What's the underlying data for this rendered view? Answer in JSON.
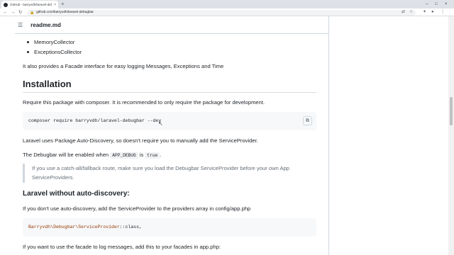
{
  "browser": {
    "tab_title": "GitHub - barryvdh/laravel-debugbar",
    "tab_close": "×",
    "new_tab": "+",
    "url": "github.com/barryvdh/laravel-debugbar",
    "window_controls": {
      "minimize": "–",
      "maximize": "□",
      "close": "×"
    },
    "nav": {
      "back": "←",
      "forward": "→",
      "reload": "↻",
      "lock": "🔒"
    }
  },
  "readme": {
    "filename": "readme.md",
    "bullets": [
      "MemoryCollector",
      "ExceptionsCollector"
    ],
    "facade_text": "It also provides a Facade interface for easy logging Messages, Exceptions and Time",
    "installation": {
      "heading": "Installation",
      "intro": "Require this package with composer. It is recommended to only require the package for development.",
      "command": "composer require barryvdh/laravel-debugbar --dev",
      "auto_discovery": "Laravel uses Package Auto-Discovery, so doesn't require you to manually add the ServiceProvider.",
      "enabled_prefix": "The Debugbar will be enabled when ",
      "enabled_code1": "APP_DEBUG",
      "enabled_is": " is ",
      "enabled_code2": "true",
      "enabled_suffix": ".",
      "note_line1": "If you use a catch-all/fallback route, make sure you load the Debugbar ServiceProvider before your own App",
      "note_line2": "ServiceProviders."
    },
    "without_auto": {
      "heading": "Laravel without auto-discovery:",
      "intro": "If you don't use auto-discovery, add the ServiceProvider to the providers array in config/app.php",
      "code_class": "Barryvdh\\Debugbar\\ServiceProvider",
      "code_suffix": "::class,",
      "facade_intro": "If you want to use the facade to log messages, add this to your facades in app.php:"
    }
  },
  "colors": {
    "code_class": "#953800",
    "text": "#1f2328",
    "muted": "#656d76"
  }
}
